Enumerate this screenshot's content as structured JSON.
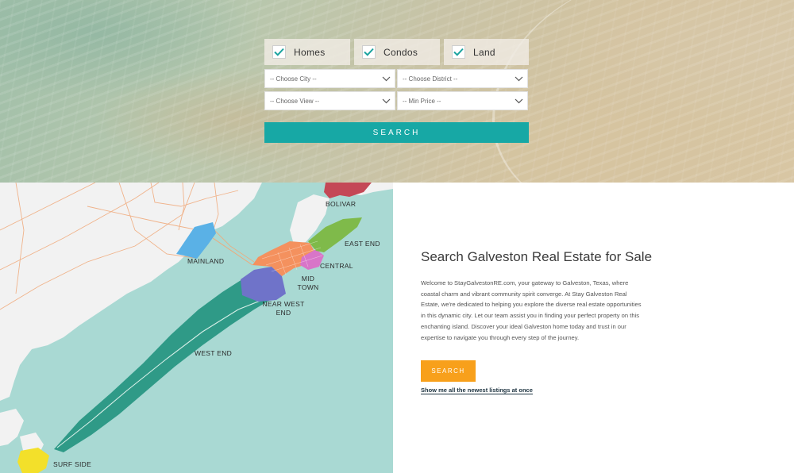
{
  "search_form": {
    "property_types": [
      {
        "label": "Homes",
        "checked": true
      },
      {
        "label": "Condos",
        "checked": true
      },
      {
        "label": "Land",
        "checked": true
      }
    ],
    "city_select": {
      "value": "-- Choose City --"
    },
    "district_select": {
      "value": "-- Choose District --"
    },
    "view_select": {
      "value": "-- Choose View --"
    },
    "price_select": {
      "value": "-- Min Price --"
    },
    "search_label": "SEARCH"
  },
  "map": {
    "regions": {
      "bolivar": "BOLIVAR",
      "mainland": "MAINLAND",
      "east_end": "EAST END",
      "central": "CENTRAL",
      "midtown": "MID TOWN",
      "near_west_end": "NEAR WEST END",
      "west_end": "WEST END",
      "surf_side": "SURF SIDE"
    },
    "colors": {
      "water": "#a9d9d3",
      "land": "#f2f2f2",
      "bolivar": "#c44856",
      "mainland": "#5ab1e6",
      "east_end": "#7fba4a",
      "central": "#f4915e",
      "midtown": "#d875c8",
      "near_west_end": "#6f73c9",
      "west_end": "#2f9a87",
      "surf_side": "#f3e02a",
      "roads": "#f0a878"
    }
  },
  "content": {
    "heading": "Search Galveston Real Estate for Sale",
    "body": "Welcome to StayGalvestonRE.com, your gateway to Galveston, Texas, where coastal charm and vibrant community spirit converge. At Stay Galveston Real Estate, we're dedicated to helping you explore the diverse real estate opportunities in this dynamic city. Let our team assist you in finding your perfect property on this enchanting island. Discover your ideal Galveston home today and trust in our expertise to navigate you through every step of the journey.",
    "search_label": "SEARCH",
    "listings_link": "Show me all the newest listings at once",
    "colors": {
      "teal_button": "#17a8a5",
      "orange_button": "#f8a01b"
    }
  }
}
